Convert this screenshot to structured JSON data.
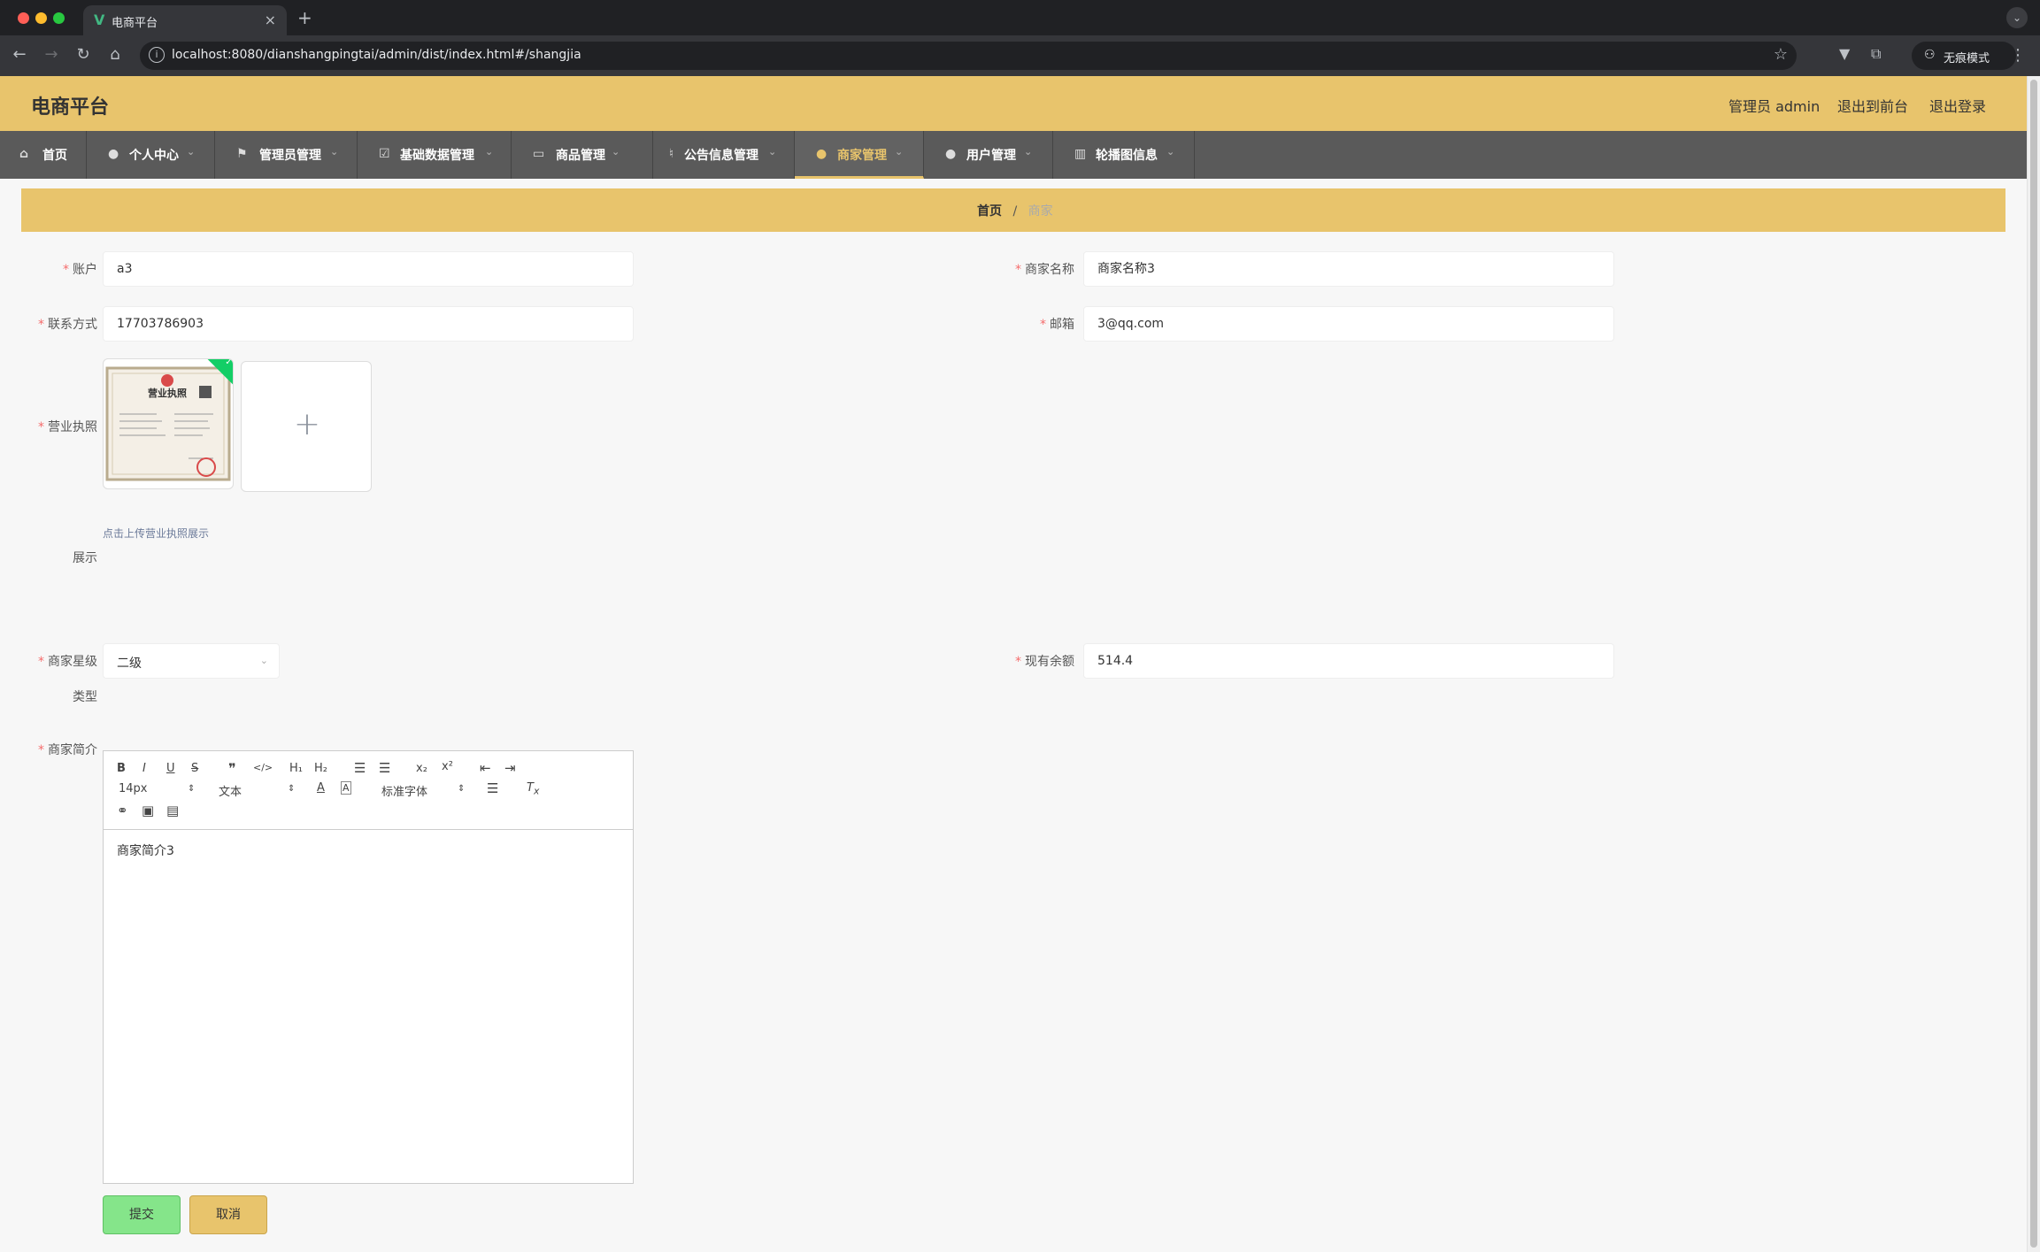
{
  "browser": {
    "tab_title": "电商平台",
    "url": "localhost:8080/dianshangpingtai/admin/dist/index.html#/shangjia",
    "incognito_label": "无痕模式"
  },
  "header": {
    "brand": "电商平台",
    "admin_label": "管理员 admin",
    "back_front": "退出到前台",
    "logout": "退出登录"
  },
  "nav": {
    "items": [
      {
        "label": "首页",
        "icon": "home-icon"
      },
      {
        "label": "个人中心",
        "icon": "user-icon"
      },
      {
        "label": "管理员管理",
        "icon": "flag-icon"
      },
      {
        "label": "基础数据管理",
        "icon": "check-icon"
      },
      {
        "label": "商品管理",
        "icon": "card-icon"
      },
      {
        "label": "公告信息管理",
        "icon": "mic-icon"
      },
      {
        "label": "商家管理",
        "icon": "location-icon"
      },
      {
        "label": "用户管理",
        "icon": "user-icon"
      },
      {
        "label": "轮播图信息",
        "icon": "chart-icon"
      }
    ]
  },
  "breadcrumb": {
    "home": "首页",
    "sep": "/",
    "current": "商家"
  },
  "form": {
    "account_label": "账户",
    "account_value": "a3",
    "name_label": "商家名称",
    "name_value": "商家名称3",
    "phone_label": "联系方式",
    "phone_value": "17703786903",
    "email_label": "邮箱",
    "email_value": "3@qq.com",
    "license_label": "营业执照",
    "license_label_2": "展示",
    "license_tip": "点击上传营业执照展示",
    "license_image_text": "营业执照",
    "level_label": "商家星级",
    "level_label_2": "类型",
    "level_value": "二级",
    "balance_label": "现有余额",
    "balance_value": "514.4",
    "intro_label": "商家简介",
    "intro_value": "商家简介3"
  },
  "editor": {
    "font_size": "14px",
    "format": "文本",
    "font_family": "标准字体"
  },
  "buttons": {
    "submit": "提交",
    "cancel": "取消"
  },
  "colors": {
    "accent": "#e8c46c",
    "nav_bg": "#5a5a5a",
    "submit": "#85e58a",
    "required": "#f56c6c"
  }
}
